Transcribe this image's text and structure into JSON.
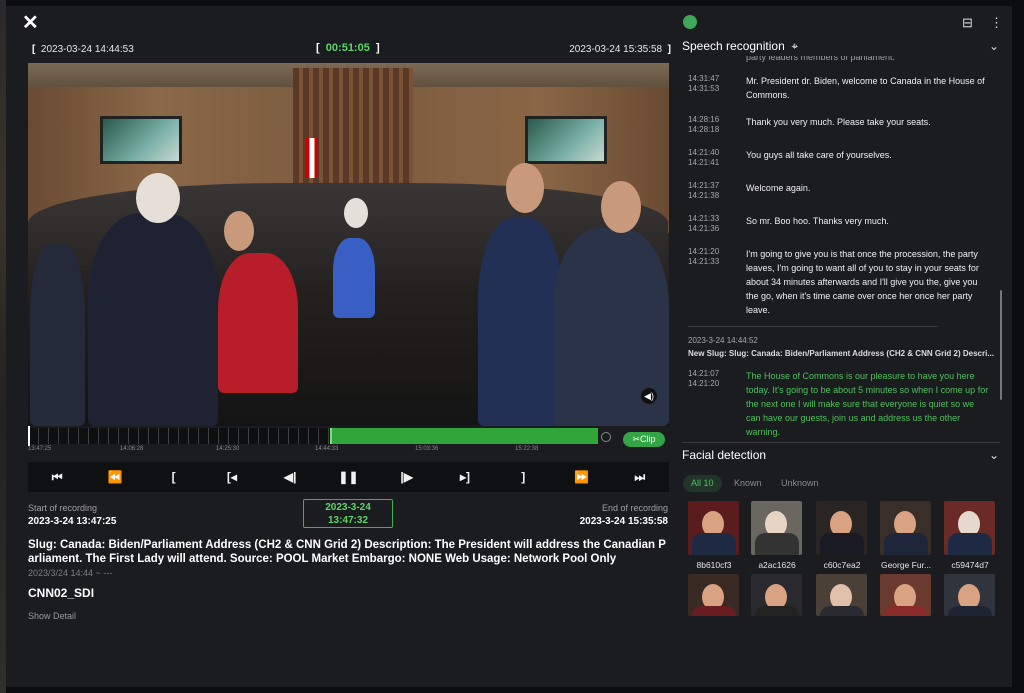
{
  "player": {
    "start_time": "2023-03-24 14:44:53",
    "elapsed": "00:51:05",
    "end_time": "2023-03-24 15:35:58",
    "timeline_labels": [
      "13:47:25",
      "14:06:28",
      "14:25:30",
      "14:44:33",
      "15:03:36",
      "15:22:38"
    ],
    "clip_label": "Clip",
    "controls": [
      "to-start",
      "rewind",
      "mark-in",
      "go-to-in",
      "step-back",
      "pause",
      "step-forward",
      "go-to-out",
      "mark-out",
      "fast-forward",
      "to-end"
    ]
  },
  "recording": {
    "start_label": "Start of recording",
    "start_value": "2023-3-24 13:47:25",
    "current_date": "2023-3-24",
    "current_time": "13:47:32",
    "end_label": "End of recording",
    "end_value": "2023-3-24 15:35:58"
  },
  "details": {
    "slug": "Slug: Canada: Biden/Parliament Address (CH2 & CNN Grid 2) Description: The President will address the Canadian P arliament. The First Lady will attend. Source: POOL Market Embargo: NONE Web Usage: Network Pool Only",
    "date_line": "2023/3/24 14:44 ~ ---",
    "source": "CNN02_SDI",
    "show_detail": "Show Detail"
  },
  "speech": {
    "title": "Speech recognition",
    "cut_top_text": "party leaders members of parliament.",
    "entries": [
      {
        "t1": "14:31:47",
        "t2": "14:31:53",
        "text": "Mr. President dr. Biden, welcome to Canada in the House of Commons."
      },
      {
        "t1": "14:28:16",
        "t2": "14:28:18",
        "text": "Thank you very much. Please take your seats."
      },
      {
        "t1": "14:21:40",
        "t2": "14:21:41",
        "text": "You guys all take care of yourselves."
      },
      {
        "t1": "14:21:37",
        "t2": "14:21:38",
        "text": "Welcome again."
      },
      {
        "t1": "14:21:33",
        "t2": "14:21:36",
        "text": "So mr. Boo hoo. Thanks very much."
      },
      {
        "t1": "14:21:20",
        "t2": "14:21:33",
        "text": "I'm going to give you is that once the procession, the party leaves, I'm going to want all of you to stay in your seats for about 34 minutes afterwards and I'll give you the, give you the go, when it's time came over once her once her party leave."
      }
    ],
    "slug_time": "2023-3-24 14:44:52",
    "slug_text": "New Slug: Slug: Canada: Biden/Parliament Address (CH2 & CNN Grid 2) Descri...",
    "active_entry": {
      "t1": "14:21:07",
      "t2": "14:21:20",
      "text": "The House of Commons is our pleasure to have you here today. It's going to be about 5 minutes so when I come up for the next one I will make sure that everyone is quiet so we can have our guests, join us and address us the other warning."
    }
  },
  "faces": {
    "title": "Facial detection",
    "filters": [
      "All 10",
      "Known",
      "Unknown"
    ],
    "names": [
      "8b610cf3",
      "a2ac1626",
      "c60c7ea2",
      "George Fur...",
      "c59474d7"
    ]
  },
  "colors": {
    "accent_green": "#33a544",
    "speech_green": "#4cc25c"
  }
}
